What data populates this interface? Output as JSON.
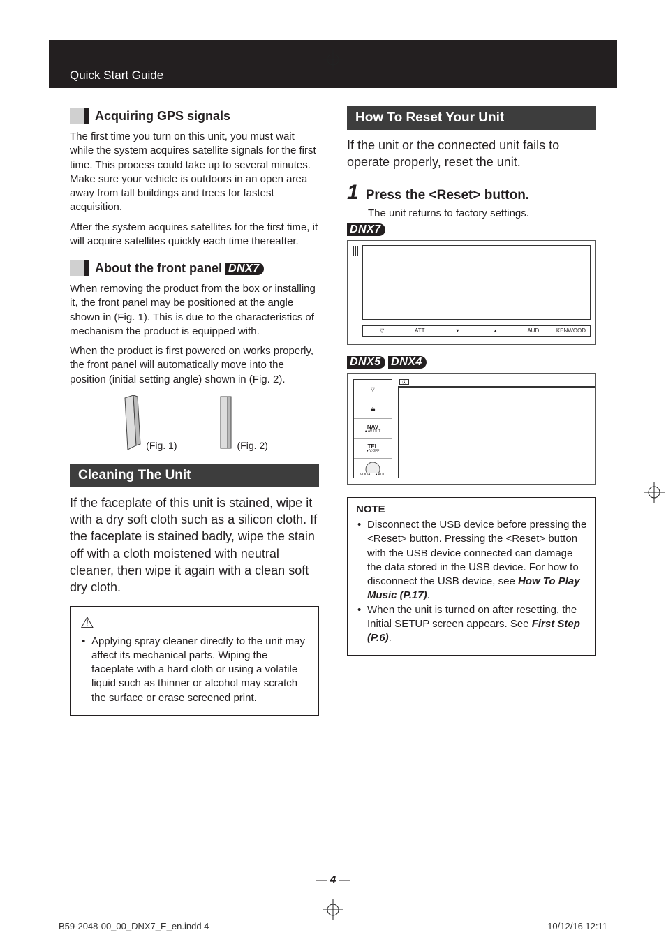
{
  "header": {
    "title": "Quick Start Guide"
  },
  "left": {
    "gps": {
      "heading": "Acquiring GPS signals",
      "p1": "The first time you turn on this unit, you must wait while the system acquires satellite signals for the first time. This process could take up to several minutes. Make sure your vehicle is outdoors in an open area away from tall buildings and trees for fastest acquisition.",
      "p2": "After the system acquires satellites for the first time, it will acquire satellites quickly each time thereafter."
    },
    "frontpanel": {
      "heading_prefix": "About the front panel ",
      "model": "DNX7",
      "p1": "When removing the product from the box or installing it, the front panel may be positioned at the angle shown in (Fig. 1). This is due to the characteristics of mechanism the product is equipped with.",
      "p2": "When the product is first powered on works properly, the front panel will automatically move into the position (initial setting angle) shown in (Fig. 2).",
      "fig1": "(Fig. 1)",
      "fig2": "(Fig. 2)"
    },
    "cleaning": {
      "heading": "Cleaning The Unit",
      "body": "If the faceplate of this unit is stained, wipe it with a dry soft cloth such as a silicon cloth. If the faceplate is stained badly, wipe the stain off with a cloth moistened with neutral cleaner, then wipe it again with a clean soft dry cloth.",
      "warn": "Applying spray cleaner directly to the unit may affect its mechanical parts. Wiping the faceplate with a hard cloth or using a volatile liquid such as thinner or alcohol may scratch the surface or erase screened print."
    }
  },
  "right": {
    "reset": {
      "heading": "How To Reset Your Unit",
      "lead": "If the unit or the connected unit fails to operate properly, reset the unit.",
      "step_num": "1",
      "step_title": "Press the <Reset> button.",
      "step_sub": "The unit returns to factory settings.",
      "model1": "DNX7",
      "illus1": {
        "buttons": [
          "▽",
          "ATT",
          "▾",
          "▴",
          "AUD",
          "KENWOOD"
        ]
      },
      "model2a": "DNX5",
      "model2b": "DNX4",
      "illus2": {
        "rows": [
          {
            "top": "▽",
            "sub": ""
          },
          {
            "top": "⏏",
            "sub": ""
          },
          {
            "top": "NAV",
            "sub": "● AV OUT"
          },
          {
            "top": "TEL",
            "sub": "● V.OFF"
          },
          {
            "top": "",
            "sub": "VOL/ATT ● AUD"
          }
        ],
        "disc": "⦿"
      },
      "note_title": "NOTE",
      "note1_a": "Disconnect the USB device before pressing the <Reset> button. Pressing the <Reset> button with the USB device connected can damage the data stored in the USB device. For how to disconnect the USB device, see ",
      "note1_ref": "How To Play Music (P.17)",
      "note1_b": ".",
      "note2_a": "When the unit is turned on after resetting, the Initial SETUP screen appears. See ",
      "note2_ref": "First Step (P.6)",
      "note2_b": "."
    }
  },
  "footer": {
    "page": "4",
    "file": "B59-2048-00_00_DNX7_E_en.indd   4",
    "timestamp": "10/12/16   12:11"
  }
}
